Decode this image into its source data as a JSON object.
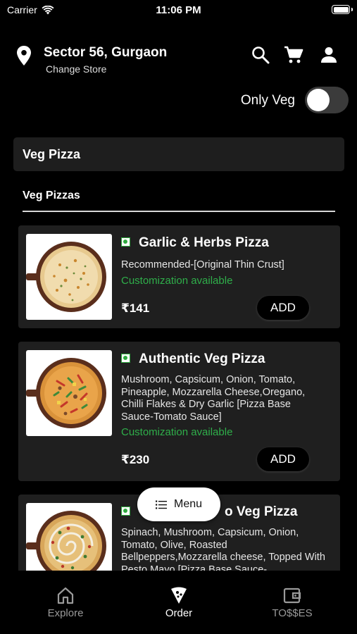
{
  "status": {
    "carrier": "Carrier",
    "time": "11:06 PM"
  },
  "header": {
    "store_name": "Sector 56, Gurgaon",
    "change_store": "Change Store"
  },
  "filter": {
    "veg_label": "Only Veg",
    "veg_only": false
  },
  "category": {
    "title": "Veg Pizza",
    "subcategory": "Veg Pizzas"
  },
  "items": [
    {
      "name": "Garlic & Herbs Pizza",
      "desc": "Recommended-[Original Thin Crust]",
      "custom": "Customization available",
      "price": "₹141",
      "add": "ADD"
    },
    {
      "name": "Authentic Veg Pizza",
      "desc": "Mushroom, Capsicum, Onion, Tomato, Pineapple, Mozzarella Cheese,Oregano, Chilli Flakes & Dry Garlic [Pizza Base Sauce-Tomato Sauce]",
      "custom": "Customization available",
      "price": "₹230",
      "add": "ADD"
    },
    {
      "name": "o Veg Pizza",
      "desc": "Spinach, Mushroom, Capsicum, Onion, Tomato, Olive, Roasted Bellpeppers,Mozzarella cheese, Topped With Pesto Mayo [Pizza Base Sauce-"
    }
  ],
  "menu_button": "Menu",
  "tabs": [
    {
      "label": "Explore",
      "icon": "home-icon",
      "active": false
    },
    {
      "label": "Order",
      "icon": "pizza-slice-icon",
      "active": true
    },
    {
      "label": "TO$$ES",
      "icon": "wallet-icon",
      "active": false
    }
  ],
  "colors": {
    "background": "#000000",
    "card": "#1f1f1f",
    "veg_green": "#2fae4a",
    "inactive_tab": "#9a9a9a"
  }
}
